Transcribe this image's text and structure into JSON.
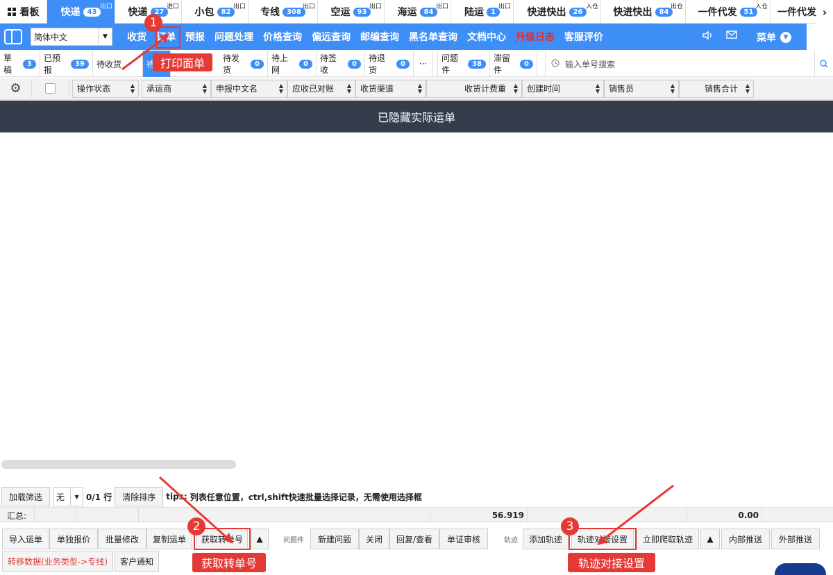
{
  "top_tabs": [
    {
      "label": "看板",
      "badge": "",
      "sup": ""
    },
    {
      "label": "快递",
      "badge": "43",
      "sup": "出口"
    },
    {
      "label": "快递",
      "badge": "27",
      "sup": "进口"
    },
    {
      "label": "小包",
      "badge": "82",
      "sup": "出口"
    },
    {
      "label": "专线",
      "badge": "308",
      "sup": "出口"
    },
    {
      "label": "空运",
      "badge": "93",
      "sup": "出口"
    },
    {
      "label": "海运",
      "badge": "84",
      "sup": "出口"
    },
    {
      "label": "陆运",
      "badge": "1",
      "sup": "出口"
    },
    {
      "label": "快进快出",
      "badge": "26",
      "sup": "入仓"
    },
    {
      "label": "快进快出",
      "badge": "84",
      "sup": "出仓"
    },
    {
      "label": "一件代发",
      "badge": "51",
      "sup": "入仓"
    },
    {
      "label": "一件代发",
      "badge": "",
      "sup": ""
    }
  ],
  "language": "简体中文",
  "nav": [
    "收货",
    "订单",
    "预报",
    "问题处理",
    "价格查询",
    "偏远查询",
    "邮编查询",
    "黑名单查询",
    "文档中心",
    "升级日志",
    "客服评价"
  ],
  "menu_label": "菜单",
  "status_tabs": [
    {
      "label": "草稿",
      "badge": "3"
    },
    {
      "label": "已预报",
      "badge": "39"
    },
    {
      "label": "待收货",
      "badge": ""
    },
    {
      "label": "待",
      "badge": ""
    },
    {
      "label": "待发货",
      "badge": "0"
    },
    {
      "label": "待上网",
      "badge": "0"
    },
    {
      "label": "待签收",
      "badge": "0"
    },
    {
      "label": "待退货",
      "badge": "0"
    },
    {
      "label": "···",
      "badge": ""
    },
    {
      "label": "问题件",
      "badge": "38"
    },
    {
      "label": "滞留件",
      "badge": "0"
    }
  ],
  "search_placeholder": "输入单号搜索",
  "columns": [
    "操作状态",
    "承运商",
    "申报中文名",
    "应收已对账",
    "收货渠道",
    "收货计费重",
    "创建时间",
    "销售员",
    "销售合计"
  ],
  "banner": "已隐藏实际运单",
  "filter": {
    "load_filter": "加载筛选",
    "select_value": "无",
    "rows_info": "0/1 行",
    "clear_sort": "清除排序",
    "tips_label": "tips:",
    "tips_text": "列表任意位置，ctrl,shift快速批量选择记录，无需使用选择框"
  },
  "summary": {
    "label": "汇总:",
    "weight": "56.919",
    "total": "0.00"
  },
  "actions_row1": {
    "import": "导入运单",
    "single_price": "单独报价",
    "batch_edit": "批量修改",
    "copy": "复制运单",
    "get_transfer": "获取转单号",
    "issue_label": "问题件",
    "new_issue": "新建问题",
    "close": "关闭",
    "reply": "回复/查看",
    "verify": "单证审核",
    "track_label": "轨迹",
    "add_track": "添加轨迹",
    "track_settings": "轨迹对接设置",
    "crawl_track": "立即爬取轨迹",
    "internal_push": "内部推送",
    "external_push": "外部推送"
  },
  "actions_row2": {
    "transfer_data": "转移数据(业务类型->专线)",
    "notify": "客户通知"
  },
  "annotations": {
    "n1": "1",
    "c1": "打印面单",
    "n2": "2",
    "c2": "获取转单号",
    "n3": "3",
    "c3": "轨迹对接设置"
  }
}
